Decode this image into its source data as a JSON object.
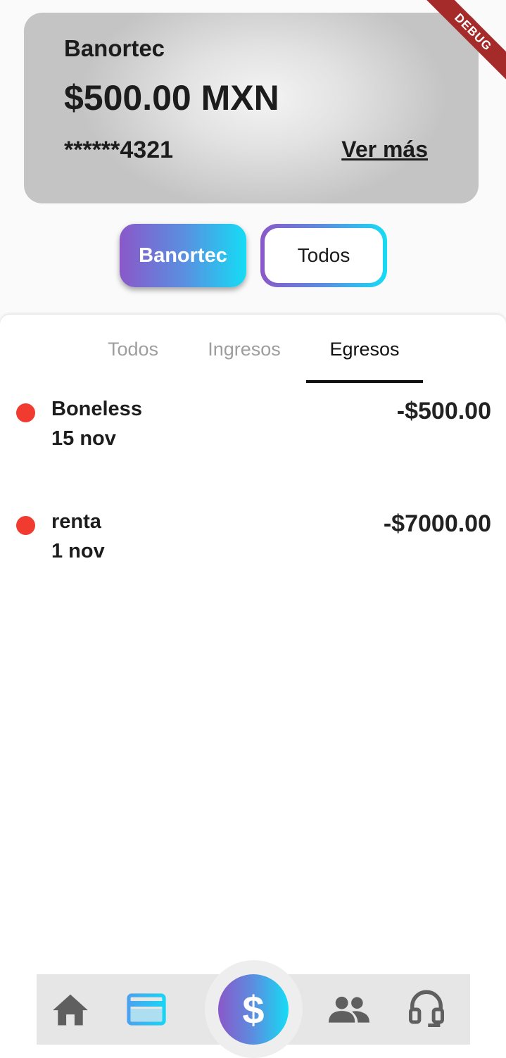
{
  "account_card": {
    "bank_name": "Banortec",
    "balance": "$500.00 MXN",
    "masked_number": "******4321",
    "more_link": "Ver más"
  },
  "debug_banner": "DEBUG",
  "filters": {
    "selected": "Banortec",
    "other": "Todos"
  },
  "tabs": [
    {
      "label": "Todos",
      "active": false
    },
    {
      "label": "Ingresos",
      "active": false
    },
    {
      "label": "Egresos",
      "active": true
    }
  ],
  "transactions": [
    {
      "name": "Boneless",
      "date": "15 nov",
      "amount": "-$500.00",
      "status_color": "#f13a30"
    },
    {
      "name": "renta",
      "date": "1 nov",
      "amount": "-$7000.00",
      "status_color": "#f13a30"
    }
  ],
  "bottom_nav": {
    "items": [
      {
        "icon": "home-icon"
      },
      {
        "icon": "credit-card-icon"
      },
      {
        "icon": "dollar-icon",
        "label": "$"
      },
      {
        "icon": "group-icon"
      },
      {
        "icon": "headset-icon"
      }
    ]
  },
  "colors": {
    "gradient_start": "#8a58c9",
    "gradient_end": "#15dcf5",
    "expense_dot": "#f13a30",
    "debug_banner": "#a52b2b"
  }
}
